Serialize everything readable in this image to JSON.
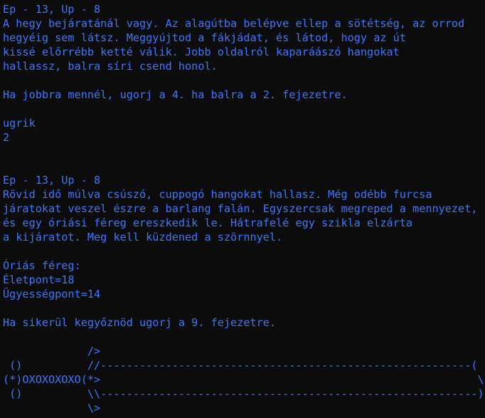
{
  "terminal": {
    "text_color": "#3b78ff",
    "background_color": "#0c0c0c",
    "lines": [
      "Ep - 13, Up - 8",
      "A hegy bejáratánál vagy. Az alagútba belépve ellep a sötétség, az orrod",
      "hegyéig sem látsz. Meggyújtod a fákjádat, és látod, hogy az út",
      "kissé előrrébb ketté válik. Jobb oldalról kaparáászó hangokat",
      "hallassz, balra síri csend honol.",
      "",
      "Ha jobbra mennél, ugorj a 4. ha balra a 2. fejezetre.",
      "",
      "ugrik",
      "2",
      "",
      "",
      "Ep - 13, Up - 8",
      "Rövid idő múlva csúszó, cuppogó hangokat hallasz. Még odébb furcsa",
      "járatokat veszel észre a barlang falán. Egyszercsak megreped a mennyezet,",
      "és egy óriási féreg ereszkedik le. Hátrafelé egy szikla elzárta",
      "a kijáratot. Meg kell küzdened a szörnnyel.",
      "",
      "Óriás féreg:",
      "Életpont=18",
      "Ügyességpont=14",
      "",
      "Ha sikerül kegyőznöd ugorj a 9. fejezetre.",
      "",
      "             />",
      " ()          //---------------------------------------------------------(",
      "(*)OXOXOXOXO(*>                                                          \\",
      " ()          \\\\----------------------------------------------------------)",
      "             \\>"
    ]
  }
}
